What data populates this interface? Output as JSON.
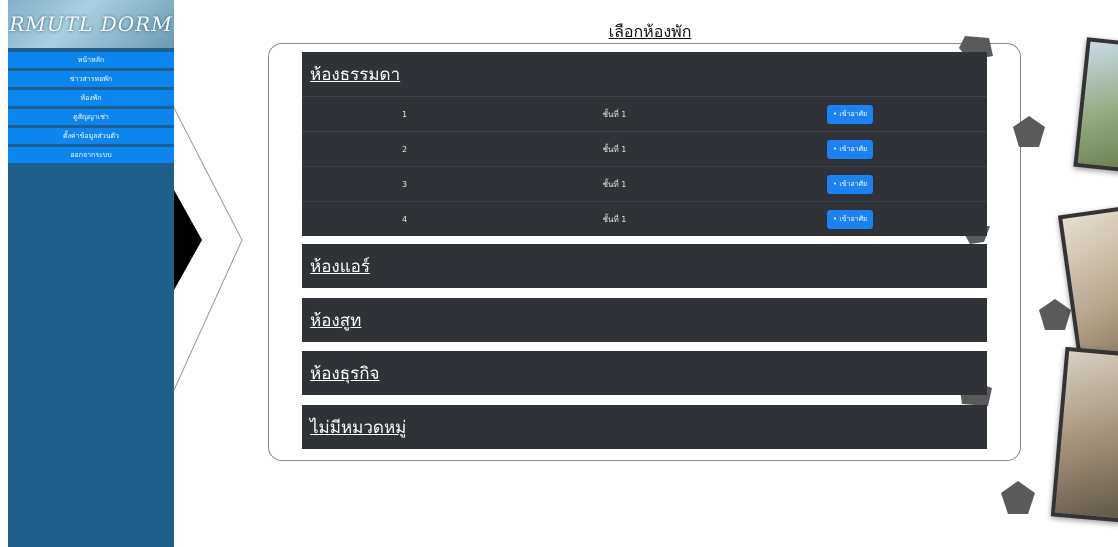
{
  "app": {
    "logo_text": "RMUTL DORM"
  },
  "sidebar": {
    "items": [
      {
        "label": "หน้าหลัก"
      },
      {
        "label": "ข่าวสารหอพัก"
      },
      {
        "label": "ห้องพัก"
      },
      {
        "label": "ดูสัญญาเช่า"
      },
      {
        "label": "ตั้งค่าข้อมูลส่วนตัว"
      },
      {
        "label": "ออกจากระบบ"
      }
    ]
  },
  "main": {
    "title": "เลือกห้องพัก",
    "categories": [
      {
        "name": "ห้องธรรมดา",
        "rooms": [
          {
            "number": "1",
            "floor": "ชั้นที่ 1",
            "action": "• เข้าอาศัย"
          },
          {
            "number": "2",
            "floor": "ชั้นที่ 1",
            "action": "• เข้าอาศัย"
          },
          {
            "number": "3",
            "floor": "ชั้นที่ 1",
            "action": "• เข้าอาศัย"
          },
          {
            "number": "4",
            "floor": "ชั้นที่ 1",
            "action": "• เข้าอาศัย"
          }
        ]
      },
      {
        "name": "ห้องแอร์"
      },
      {
        "name": "ห้องสูท"
      },
      {
        "name": "ห้องธุรกิจ"
      },
      {
        "name": "ไม่มีหมวดหมู่"
      }
    ]
  },
  "colors": {
    "sidebar": "#1f5f8b",
    "menu_item": "#0b86f0",
    "panel": "#2f3236",
    "button": "#1a82f5"
  }
}
